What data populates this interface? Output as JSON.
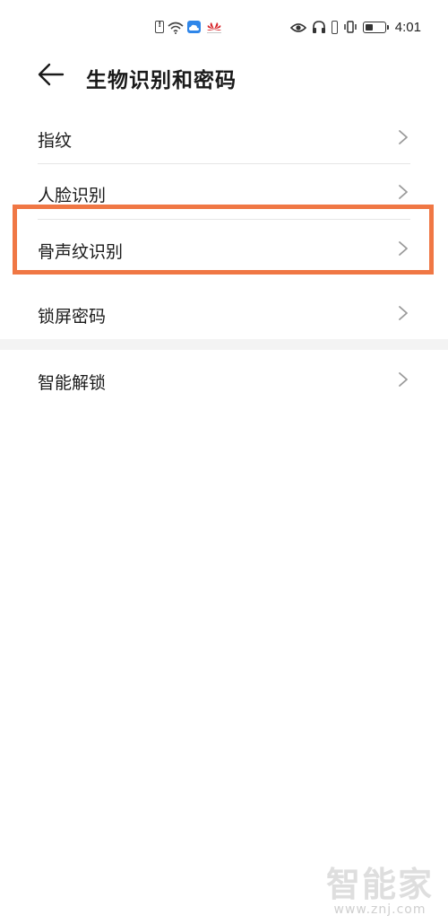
{
  "status_bar": {
    "time": "4:01",
    "battery_fraction": 0.4,
    "icons": [
      "sim-alert-icon",
      "wifi-icon",
      "cloud-icon",
      "huawei-icon",
      "eye-icon",
      "headphones-icon",
      "battery-saver-icon",
      "vibrate-icon",
      "battery-icon"
    ]
  },
  "header": {
    "title": "生物识别和密码"
  },
  "list": {
    "items": [
      {
        "label": "指纹"
      },
      {
        "label": "人脸识别"
      },
      {
        "label": "骨声纹识别"
      },
      {
        "label": "锁屏密码"
      },
      {
        "label": "智能解锁"
      }
    ]
  },
  "annotation": {
    "highlight_color": "#f07744"
  },
  "watermark": {
    "title": "智能家",
    "url": "www.znj.com"
  }
}
